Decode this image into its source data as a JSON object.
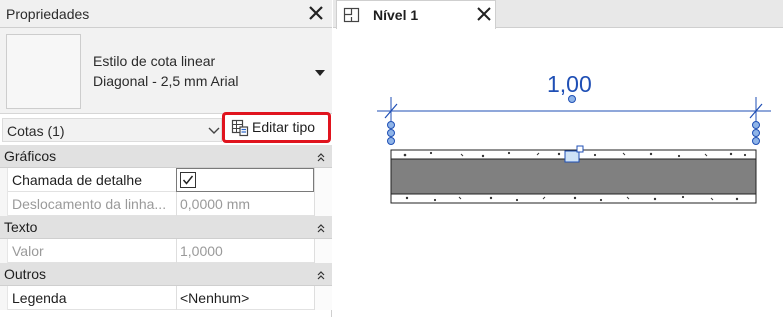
{
  "properties": {
    "title": "Propriedades",
    "type_selector": {
      "line1": "Estilo de cota linear",
      "line2": "Diagonal - 2,5 mm Arial"
    },
    "filter": "Cotas (1)",
    "edit_type_label": "Editar tipo",
    "sections": [
      {
        "label": "Gráficos",
        "rows": [
          {
            "name": "Chamada de detalhe",
            "value": ""
          },
          {
            "name": "Deslocamento da linha...",
            "value": "0,0000 mm"
          }
        ]
      },
      {
        "label": "Texto",
        "rows": [
          {
            "name": "Valor",
            "value": "1,0000"
          }
        ]
      },
      {
        "label": "Outros",
        "rows": [
          {
            "name": "Legenda",
            "value": "<Nenhum>"
          }
        ]
      }
    ],
    "detail_callout_checked": true
  },
  "view": {
    "tab_label": "Nível 1",
    "dimension_value": "1,00"
  },
  "colors": {
    "highlight_border": "#e0141e",
    "dimension_blue": "#1f4fb5",
    "wall_core": "#808080"
  }
}
